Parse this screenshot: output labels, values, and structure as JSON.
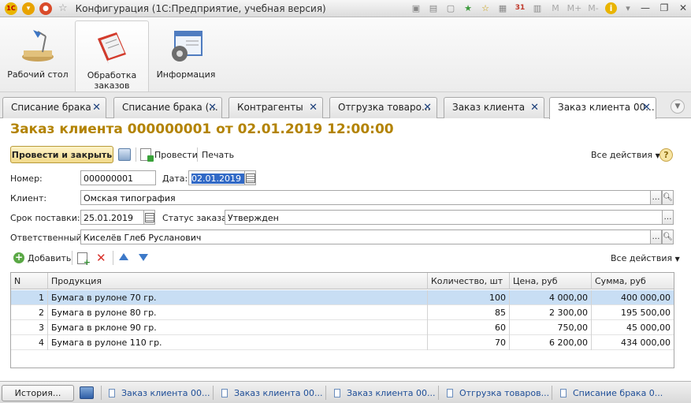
{
  "window": {
    "title": "Конфигурация  (1С:Предприятие, учебная версия)",
    "logo_text": "1С",
    "toolbar_m_labels": [
      "M",
      "M+",
      "M-"
    ],
    "calendar_day": "31"
  },
  "sections": [
    {
      "label": "Рабочий стол",
      "icon": "desk-lamp-icon"
    },
    {
      "label": "Обработка заказов",
      "icon": "book-icon"
    },
    {
      "label": "Информация",
      "icon": "window-gear-icon"
    }
  ],
  "tabs": [
    {
      "label": "Списание брака"
    },
    {
      "label": "Списание брака (..."
    },
    {
      "label": "Контрагенты"
    },
    {
      "label": "Отгрузка товаро..."
    },
    {
      "label": "Заказ клиента"
    },
    {
      "label": "Заказ клиента 00..."
    }
  ],
  "form": {
    "title": "Заказ клиента 000000001 от 02.01.2019 12:00:00",
    "post_and_close": "Провести и закрыть",
    "post": "Провести",
    "print": "Печать",
    "all_actions": "Все действия",
    "help": "?",
    "number_label": "Номер:",
    "number_value": "000000001",
    "date_label": "Дата:",
    "date_value": "02.01.2019 1",
    "client_label": "Клиент:",
    "client_value": "Омская типография",
    "delivery_label": "Срок поставки:",
    "delivery_value": "25.01.2019",
    "status_label": "Статус заказа:",
    "status_value": "Утвержден",
    "responsible_label": "Ответственный:",
    "responsible_value": "Киселёв Глеб Русланович",
    "add_label": "Добавить",
    "table_all_actions": "Все действия"
  },
  "table": {
    "columns": [
      "N",
      "Продукция",
      "Количество, шт",
      "Цена, руб",
      "Сумма, руб"
    ],
    "rows": [
      {
        "n": "1",
        "product": "Бумага в рулоне 70 гр.",
        "qty": "100",
        "price": "4 000,00",
        "sum": "400 000,00"
      },
      {
        "n": "2",
        "product": "Бумага в рулоне 80 гр.",
        "qty": "85",
        "price": "2 300,00",
        "sum": "195 500,00"
      },
      {
        "n": "3",
        "product": "Бумага в рклоне 90 гр.",
        "qty": "60",
        "price": "750,00",
        "sum": "45 000,00"
      },
      {
        "n": "4",
        "product": "Бумага в рулоне 110 гр.",
        "qty": "70",
        "price": "6 200,00",
        "sum": "434 000,00"
      }
    ],
    "selected_row": 0
  },
  "bottom": {
    "history": "История...",
    "open_windows": [
      "Заказ клиента 00...",
      "Заказ клиента 00...",
      "Заказ клиента 00...",
      "Отгрузка товаров...",
      "Списание брака 0..."
    ]
  },
  "colors": {
    "title_accent": "#b38300",
    "selected_row": "#c8def4",
    "primary_button": "#f1d98a",
    "link_blue": "#1d4d97"
  }
}
